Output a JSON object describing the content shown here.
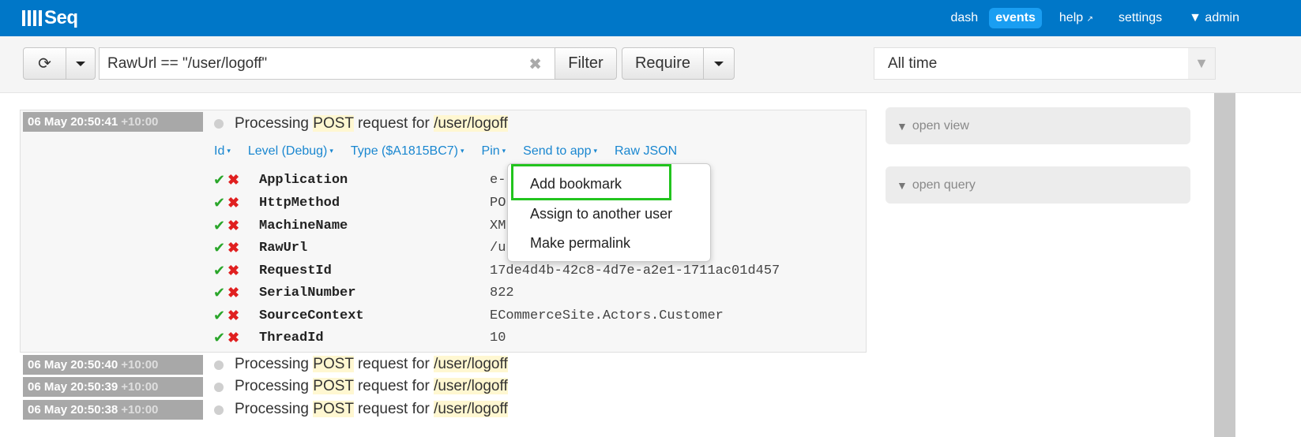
{
  "app": {
    "logo_text": "Seq"
  },
  "nav": {
    "dash": "dash",
    "events": "events",
    "help": "help",
    "help_icon": "↗",
    "settings": "settings",
    "admin": "▼ admin"
  },
  "toolbar": {
    "query": "RawUrl == \"/user/logoff\"",
    "clear_icon": "✖",
    "refresh_icon": "⟳",
    "filter_label": "Filter",
    "require_label": "Require",
    "time_range": "All time",
    "time_caret": "▼"
  },
  "expanded_event": {
    "date": "06 May 20:50:41",
    "tz": "+10:00",
    "msg_prefix": "Processing ",
    "msg_method": "POST",
    "msg_middle": " request for ",
    "msg_url": "/user/logoff",
    "actions": [
      {
        "label": "Id"
      },
      {
        "label": "Level (Debug)"
      },
      {
        "label": "Type ($A1815BC7)"
      },
      {
        "label": "Pin"
      },
      {
        "label": "Send to app"
      },
      {
        "label": "Raw JSON"
      }
    ],
    "properties": [
      {
        "name": "Application",
        "value": "e-"
      },
      {
        "name": "HttpMethod",
        "value": "PO"
      },
      {
        "name": "MachineName",
        "value": "XM"
      },
      {
        "name": "RawUrl",
        "value": "/u"
      },
      {
        "name": "RequestId",
        "value": "17de4d4b-42c8-4d7e-a2e1-1711ac01d457"
      },
      {
        "name": "SerialNumber",
        "value": "822"
      },
      {
        "name": "SourceContext",
        "value": "ECommerceSite.Actors.Customer"
      },
      {
        "name": "ThreadId",
        "value": "10"
      }
    ]
  },
  "dropdown": {
    "items": [
      "Add bookmark",
      "Assign to another user",
      "Make permalink"
    ]
  },
  "events": [
    {
      "date": "06 May 20:50:40",
      "tz": "+10:00",
      "msg_prefix": "Processing ",
      "msg_method": "POST",
      "msg_middle": " request for ",
      "msg_url": "/user/logoff"
    },
    {
      "date": "06 May 20:50:39",
      "tz": "+10:00",
      "msg_prefix": "Processing ",
      "msg_method": "POST",
      "msg_middle": " request for ",
      "msg_url": "/user/logoff"
    },
    {
      "date": "06 May 20:50:38",
      "tz": "+10:00",
      "msg_prefix": "Processing ",
      "msg_method": "POST",
      "msg_middle": " request for ",
      "msg_url": "/user/logoff"
    }
  ],
  "side_panels": {
    "open_view": "open view",
    "open_query": "open query",
    "triangle": "▼"
  },
  "icons": {
    "check": "✔",
    "cross": "✖",
    "small_caret": "▾"
  },
  "colors": {
    "topbar": "#0077c8",
    "active_nav": "#1a9ef2",
    "link": "#1a87d0",
    "highlight_box": "#22c41e"
  }
}
